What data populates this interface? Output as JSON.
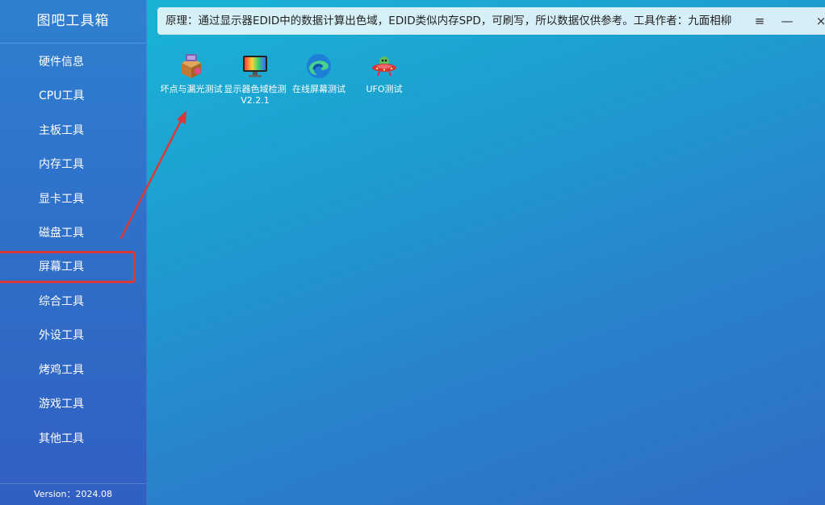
{
  "app": {
    "title": "图吧工具箱",
    "version": "Version：2024.08"
  },
  "sidebar": {
    "items": [
      {
        "label": "硬件信息"
      },
      {
        "label": "CPU工具"
      },
      {
        "label": "主板工具"
      },
      {
        "label": "内存工具"
      },
      {
        "label": "显卡工具"
      },
      {
        "label": "磁盘工具"
      },
      {
        "label": "屏幕工具"
      },
      {
        "label": "综合工具"
      },
      {
        "label": "外设工具"
      },
      {
        "label": "烤鸡工具"
      },
      {
        "label": "游戏工具"
      },
      {
        "label": "其他工具"
      }
    ]
  },
  "topbar": {
    "notice": "原理：通过显示器EDID中的数据计算出色域，EDID类似内存SPD，可刷写，所以数据仅供参考。工具作者：九面相柳",
    "menu_glyph": "≡",
    "minimize_glyph": "—",
    "close_glyph": "×"
  },
  "tools": [
    {
      "label": "坏点与漏光测试",
      "icon": "box-tool-icon"
    },
    {
      "label": "显示器色域检测V2.2.1",
      "icon": "monitor-color-icon"
    },
    {
      "label": "在线屏幕测试",
      "icon": "edge-browser-icon"
    },
    {
      "label": "UFO测试",
      "icon": "ufo-icon"
    }
  ],
  "colors": {
    "highlight": "#d83a3a",
    "arrow": "#d83a3a"
  }
}
